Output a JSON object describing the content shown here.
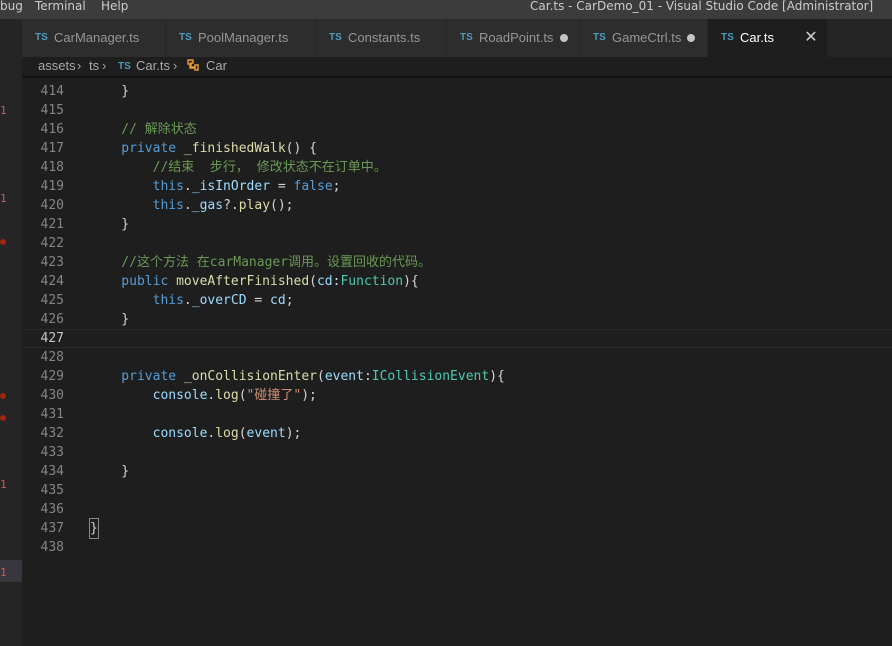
{
  "titlebar": {
    "menu": [
      "bug",
      "Terminal",
      "Help"
    ],
    "window_title": "Car.ts - CarDemo_01 - Visual Studio Code [Administrator]"
  },
  "tabs": [
    {
      "badge": "TS",
      "name": "CarManager.ts",
      "modified": false,
      "active": false
    },
    {
      "badge": "TS",
      "name": "PoolManager.ts",
      "modified": false,
      "active": false
    },
    {
      "badge": "TS",
      "name": "Constants.ts",
      "modified": false,
      "active": false
    },
    {
      "badge": "TS",
      "name": "RoadPoint.ts",
      "modified": true,
      "active": false
    },
    {
      "badge": "TS",
      "name": "GameCtrl.ts",
      "modified": true,
      "active": false
    },
    {
      "badge": "TS",
      "name": "Car.ts",
      "modified": false,
      "active": true,
      "close": "✕"
    }
  ],
  "breadcrumb": {
    "folder1": "assets",
    "folder2": "ts",
    "file_badge": "TS",
    "file": "Car.ts",
    "symbol_icon": "class-icon",
    "symbol": "Car",
    "separator": "›"
  },
  "gutter_markers": [
    "1",
    "1",
    "1",
    "1"
  ],
  "colors": {
    "editor_bg": "#1e1e1e",
    "keyword": "#569cd6",
    "function": "#dcdcaa",
    "variable": "#9cdcfe",
    "type": "#4ec9b0",
    "string": "#ce9178",
    "comment": "#6a9955",
    "plain": "#d4d4d4",
    "line_number": "#858585",
    "ts_badge": "#519aba"
  },
  "code_lines": [
    {
      "num": "414",
      "tokens": [
        {
          "t": "    }",
          "c": "#d4d4d4"
        }
      ]
    },
    {
      "num": "415",
      "tokens": []
    },
    {
      "num": "416",
      "tokens": [
        {
          "t": "    // 解除状态",
          "c": "#6a9955"
        }
      ]
    },
    {
      "num": "417",
      "tokens": [
        {
          "t": "    private ",
          "c": "#569cd6"
        },
        {
          "t": "_finishedWalk",
          "c": "#dcdcaa"
        },
        {
          "t": "() {",
          "c": "#d4d4d4"
        }
      ]
    },
    {
      "num": "418",
      "tokens": [
        {
          "t": "        //结束  步行， 修改状态不在订单中。",
          "c": "#6a9955"
        }
      ]
    },
    {
      "num": "419",
      "tokens": [
        {
          "t": "        this",
          "c": "#569cd6"
        },
        {
          "t": ".",
          "c": "#d4d4d4"
        },
        {
          "t": "_isInOrder",
          "c": "#9cdcfe"
        },
        {
          "t": " = ",
          "c": "#d4d4d4"
        },
        {
          "t": "false",
          "c": "#569cd6"
        },
        {
          "t": ";",
          "c": "#d4d4d4"
        }
      ]
    },
    {
      "num": "420",
      "tokens": [
        {
          "t": "        this",
          "c": "#569cd6"
        },
        {
          "t": ".",
          "c": "#d4d4d4"
        },
        {
          "t": "_gas",
          "c": "#9cdcfe"
        },
        {
          "t": "?.",
          "c": "#d4d4d4"
        },
        {
          "t": "play",
          "c": "#dcdcaa"
        },
        {
          "t": "();",
          "c": "#d4d4d4"
        }
      ]
    },
    {
      "num": "421",
      "tokens": [
        {
          "t": "    }",
          "c": "#d4d4d4"
        }
      ]
    },
    {
      "num": "422",
      "tokens": []
    },
    {
      "num": "423",
      "tokens": [
        {
          "t": "    //这个方法 在carManager调用。设置回收的代码。",
          "c": "#6a9955"
        }
      ]
    },
    {
      "num": "424",
      "tokens": [
        {
          "t": "    public ",
          "c": "#569cd6"
        },
        {
          "t": "moveAfterFinished",
          "c": "#dcdcaa"
        },
        {
          "t": "(",
          "c": "#d4d4d4"
        },
        {
          "t": "cd",
          "c": "#9cdcfe"
        },
        {
          "t": ":",
          "c": "#d4d4d4"
        },
        {
          "t": "Function",
          "c": "#4ec9b0"
        },
        {
          "t": "){",
          "c": "#d4d4d4"
        }
      ]
    },
    {
      "num": "425",
      "tokens": [
        {
          "t": "        this",
          "c": "#569cd6"
        },
        {
          "t": ".",
          "c": "#d4d4d4"
        },
        {
          "t": "_overCD",
          "c": "#9cdcfe"
        },
        {
          "t": " = ",
          "c": "#d4d4d4"
        },
        {
          "t": "cd",
          "c": "#9cdcfe"
        },
        {
          "t": ";",
          "c": "#d4d4d4"
        }
      ]
    },
    {
      "num": "426",
      "tokens": [
        {
          "t": "    }",
          "c": "#d4d4d4"
        }
      ]
    },
    {
      "num": "427",
      "tokens": [],
      "current": true
    },
    {
      "num": "428",
      "tokens": []
    },
    {
      "num": "429",
      "tokens": [
        {
          "t": "    private ",
          "c": "#569cd6"
        },
        {
          "t": "_onCollisionEnter",
          "c": "#dcdcaa"
        },
        {
          "t": "(",
          "c": "#d4d4d4"
        },
        {
          "t": "event",
          "c": "#9cdcfe"
        },
        {
          "t": ":",
          "c": "#d4d4d4"
        },
        {
          "t": "ICollisionEvent",
          "c": "#4ec9b0"
        },
        {
          "t": "){",
          "c": "#d4d4d4"
        }
      ]
    },
    {
      "num": "430",
      "tokens": [
        {
          "t": "        console",
          "c": "#9cdcfe"
        },
        {
          "t": ".",
          "c": "#d4d4d4"
        },
        {
          "t": "log",
          "c": "#dcdcaa"
        },
        {
          "t": "(",
          "c": "#d4d4d4"
        },
        {
          "t": "\"碰撞了\"",
          "c": "#ce9178"
        },
        {
          "t": ");",
          "c": "#d4d4d4"
        }
      ]
    },
    {
      "num": "431",
      "tokens": []
    },
    {
      "num": "432",
      "tokens": [
        {
          "t": "        console",
          "c": "#9cdcfe"
        },
        {
          "t": ".",
          "c": "#d4d4d4"
        },
        {
          "t": "log",
          "c": "#dcdcaa"
        },
        {
          "t": "(",
          "c": "#d4d4d4"
        },
        {
          "t": "event",
          "c": "#9cdcfe"
        },
        {
          "t": ");",
          "c": "#d4d4d4"
        }
      ]
    },
    {
      "num": "433",
      "tokens": []
    },
    {
      "num": "434",
      "tokens": [
        {
          "t": "    }",
          "c": "#d4d4d4"
        }
      ]
    },
    {
      "num": "435",
      "tokens": []
    },
    {
      "num": "436",
      "tokens": []
    },
    {
      "num": "437",
      "tokens": [
        {
          "t": "}",
          "c": "#d4d4d4",
          "cursor": true
        }
      ]
    },
    {
      "num": "438",
      "tokens": []
    }
  ]
}
